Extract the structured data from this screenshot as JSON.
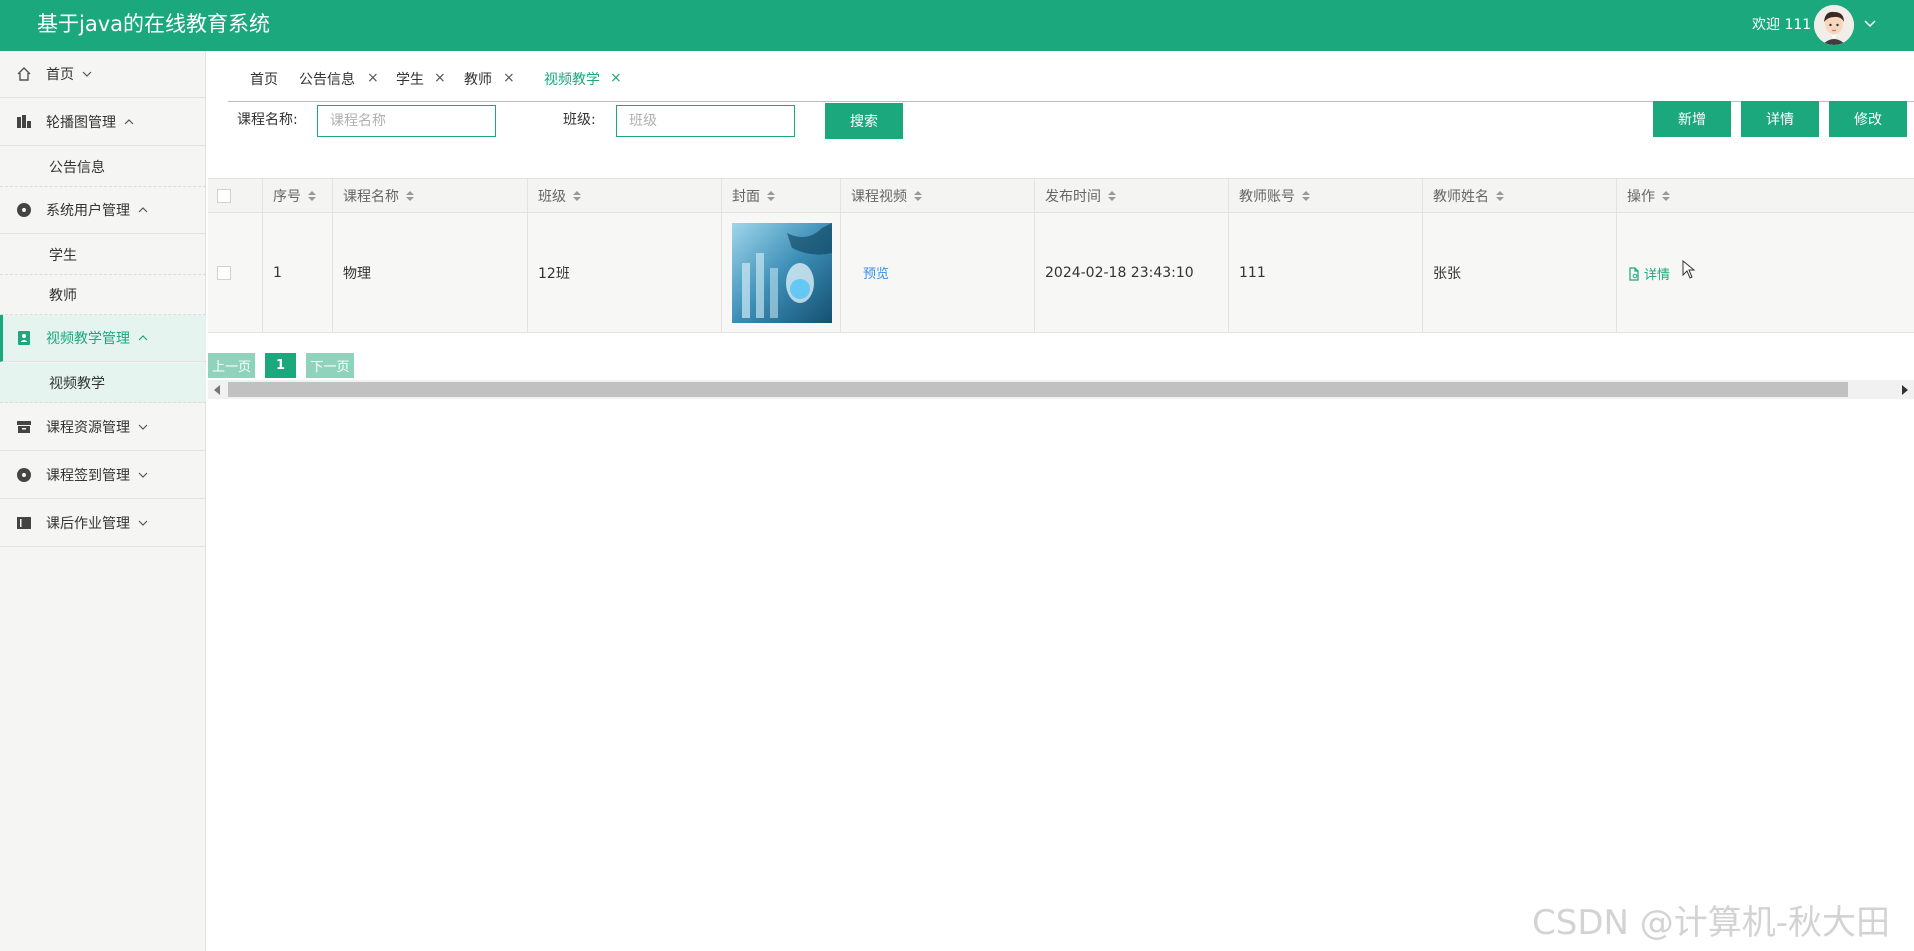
{
  "app": {
    "title": "基于java的在线教育系统",
    "welcome": "欢迎 111"
  },
  "colors": {
    "primary": "#1aa87c",
    "sidebar_bg": "#f5f5f4",
    "link_blue": "#3a8ee6"
  },
  "sidebar": {
    "items": [
      {
        "label": "首页",
        "icon": "home-icon",
        "arrow": "down"
      },
      {
        "label": "轮播图管理",
        "icon": "chart-icon",
        "arrow": "up"
      },
      {
        "label": "公告信息"
      },
      {
        "label": "系统用户管理",
        "icon": "disc-icon",
        "arrow": "up"
      },
      {
        "label": "学生"
      },
      {
        "label": "教师"
      },
      {
        "label": "视频教学管理",
        "icon": "contact-icon",
        "arrow": "up"
      },
      {
        "label": "视频教学"
      },
      {
        "label": "课程资源管理",
        "icon": "archive-icon",
        "arrow": "down"
      },
      {
        "label": "课程签到管理",
        "icon": "disc-icon",
        "arrow": "down"
      },
      {
        "label": "课后作业管理",
        "icon": "book-icon",
        "arrow": "down"
      }
    ]
  },
  "tabs": [
    {
      "label": "首页"
    },
    {
      "label": "公告信息"
    },
    {
      "label": "学生"
    },
    {
      "label": "教师"
    },
    {
      "label": "视频教学"
    }
  ],
  "tab_close": "×",
  "search": {
    "course_label": "课程名称:",
    "course_placeholder": "课程名称",
    "class_label": "班级:",
    "class_placeholder": "班级",
    "search_button": "搜索"
  },
  "actions": {
    "add": "新增",
    "detail": "详情",
    "edit": "修改"
  },
  "table": {
    "headers": [
      "序号",
      "课程名称",
      "班级",
      "封面",
      "课程视频",
      "发布时间",
      "教师账号",
      "教师姓名",
      "操作"
    ],
    "rows": [
      {
        "index": "1",
        "course_name": "物理",
        "class": "12班",
        "video": "预览",
        "publish_time": "2024-02-18 23:43:10",
        "teacher_account": "111",
        "teacher_name": "张张",
        "op": "详情"
      }
    ]
  },
  "pagination": {
    "prev": "上一页",
    "current": "1",
    "next": "下一页"
  },
  "watermark": "CSDN @计算机-秋大田"
}
